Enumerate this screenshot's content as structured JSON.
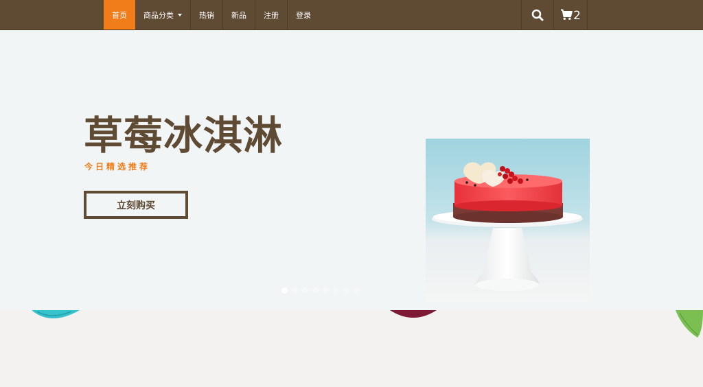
{
  "nav": {
    "items": [
      {
        "label": "首页",
        "active": true
      },
      {
        "label": "商品分类",
        "dropdown": true
      },
      {
        "label": "热销"
      },
      {
        "label": "新品"
      },
      {
        "label": "注册"
      },
      {
        "label": "登录"
      }
    ],
    "search_icon": "search-icon",
    "cart_icon": "cart-icon",
    "cart_count": "2"
  },
  "hero": {
    "title": "草莓冰淇淋",
    "subtitle": "今日精选推荐",
    "button_label": "立刻购买",
    "image_icon": "strawberry-cake-image",
    "slides_count": 8,
    "active_slide": 0
  },
  "colors": {
    "nav_bg": "#5f4a33",
    "accent": "#f07c1a",
    "brand_brown": "#5f4a33",
    "hero_bg": "#f2f5f6"
  }
}
